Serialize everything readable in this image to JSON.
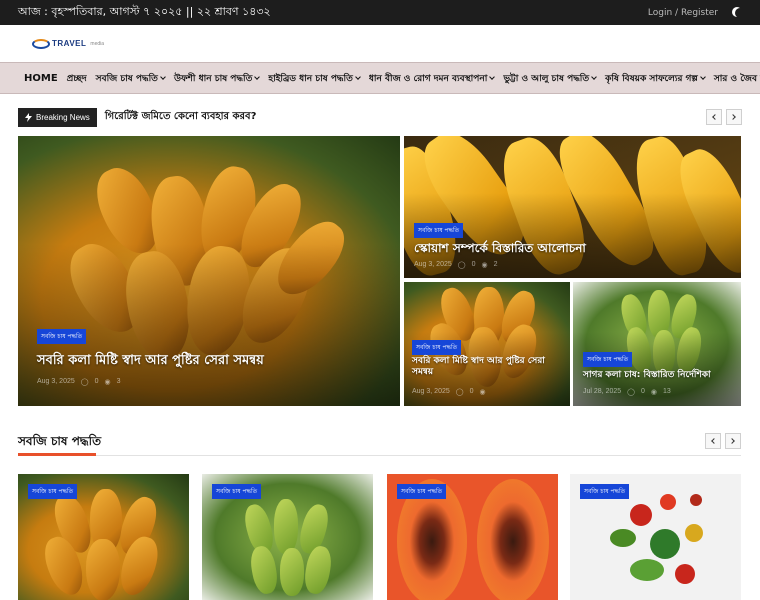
{
  "topbar": {
    "date_text": "আজ : বৃহস্পতিবার, আগস্ট ৭ ২০২৫ || ২২ শ্রাবণ ১৪৩২",
    "login_text": "Login / Register",
    "dark_mode_icon": "moon-icon"
  },
  "brand": {
    "logo_text": "TRAVEL",
    "logo_sub": "media"
  },
  "nav": {
    "items": [
      {
        "label": "HOME",
        "dropdown": false
      },
      {
        "label": "প্রচ্ছদ",
        "dropdown": false
      },
      {
        "label": "সবজি চাষ পদ্ধতি",
        "dropdown": true
      },
      {
        "label": "উফশী ধান চাষ পদ্ধতি",
        "dropdown": true
      },
      {
        "label": "হাইব্রিড ধান চাষ পদ্ধতি",
        "dropdown": true
      },
      {
        "label": "ধান বীজ ও রোগ দমন ব্যবস্থাপনা",
        "dropdown": true
      },
      {
        "label": "ভুট্টা ও আলু চাষ পদ্ধতি",
        "dropdown": true
      },
      {
        "label": "কৃষি বিষয়ক সাফল্যের গল্প",
        "dropdown": true
      },
      {
        "label": "সার ও জৈব বালাইনা",
        "dropdown": false
      }
    ]
  },
  "breaking": {
    "label": "Breaking News",
    "headline": "গিরেটিক্ট জমিতে কেনো ব্যবহার করব?"
  },
  "featured": [
    {
      "badge": "সবজি চাষ পদ্ধতি",
      "title": "সবরি কলা মিষ্টি স্বাদ আর পুষ্টির সেরা সমন্বয়",
      "date": "Aug 3, 2025",
      "comments": "0",
      "views": "3"
    },
    {
      "badge": "সবজি চাষ পদ্ধতি",
      "title": "স্কোয়াশ সম্পর্কে বিস্তারিত আলোচনা",
      "date": "Aug 3, 2025",
      "comments": "0",
      "views": "2"
    },
    {
      "badge": "সবজি চাষ পদ্ধতি",
      "title": "সবরি কলা মিষ্টি স্বাদ আর পুষ্টির সেরা সমন্বয়",
      "date": "Aug 3, 2025",
      "comments": "0",
      "views": ""
    },
    {
      "badge": "সবজি চাষ পদ্ধতি",
      "title": "সাগর কলা চাষ: বিস্তারিত নির্দেশিকা",
      "date": "Jul 28, 2025",
      "comments": "0",
      "views": "13"
    }
  ],
  "section": {
    "title": "সবজি চাষ পদ্ধতি",
    "accent": "#e8502a",
    "tiles": [
      {
        "badge": "সবজি চাষ পদ্ধতি"
      },
      {
        "badge": "সবজি চাষ পদ্ধতি"
      },
      {
        "badge": "সবজি চাষ পদ্ধতি"
      },
      {
        "badge": "সবজি চাষ পদ্ধতি"
      }
    ]
  },
  "colors": {
    "badge": "#1646d8",
    "topbar": "#1d1d1d",
    "nav": "#e4d8d8"
  }
}
